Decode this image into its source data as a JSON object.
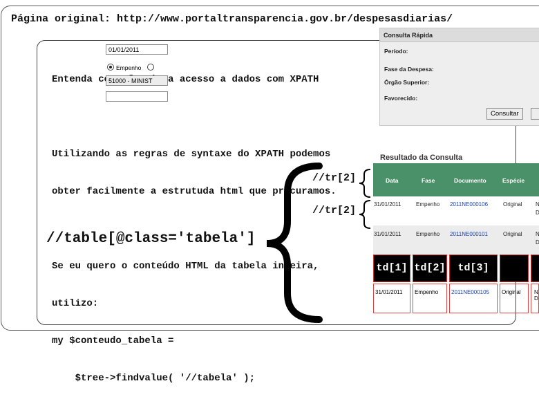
{
  "header": {
    "page_url_line": "Página original: http://www.portaltransparencia.gov.br/despesasdiarias/"
  },
  "explanation": {
    "lines": [
      "Entenda como funciona acesso a dados com XPATH",
      "",
      "Utilizando as regras de syntaxe do XPATH podemos",
      "obter facilmente a estrutuda html que procuramos.",
      "",
      "Se eu quero o conteúdo HTML da tabela inteira,",
      "utilizo:",
      "my $conteudo_tabela =",
      "    $tree->findvalue( '//tabela' );"
    ]
  },
  "annotations": {
    "table_xpath": "//table[@class='tabela']",
    "tr_xpath_1": "//tr[2]",
    "tr_xpath_2": "//tr[2]",
    "td_labels": [
      "td[1]",
      "td[2]",
      "td[3]"
    ]
  },
  "quick_search": {
    "title": "Consulta Rápida",
    "periodo_label": "Período:",
    "periodo_value": "01/01/2011",
    "fase_label": "Fase da Despesa:",
    "fase_option": "Empenho",
    "orgao_label": "Órgão Superior:",
    "orgao_value": "51000 - MINIST",
    "favorecido_label": "Favorecido:",
    "favorecido_value": "",
    "consultar_button": "Consultar"
  },
  "results": {
    "title": "Resultado da Consulta",
    "columns": [
      "Data",
      "Fase",
      "Documento",
      "Espécie"
    ],
    "rows": [
      {
        "data": "31/01/2011",
        "fase": "Empenho",
        "documento": "2011NE000106",
        "especie": "Original",
        "extra": [
          "N",
          "D"
        ]
      },
      {
        "data": "31/01/2011",
        "fase": "Empenho",
        "documento": "2011NE000101",
        "especie": "Original",
        "extra": [
          "N",
          "D"
        ]
      },
      {
        "data": "31/01/2011",
        "fase": "Empenho",
        "documento": "2011NE000105",
        "especie": "Original",
        "extra": [
          "N",
          "D"
        ]
      }
    ]
  },
  "colors": {
    "header_green": "#4a9068",
    "link_blue": "#1a3fb0",
    "td_border_red": "#cc3333"
  }
}
